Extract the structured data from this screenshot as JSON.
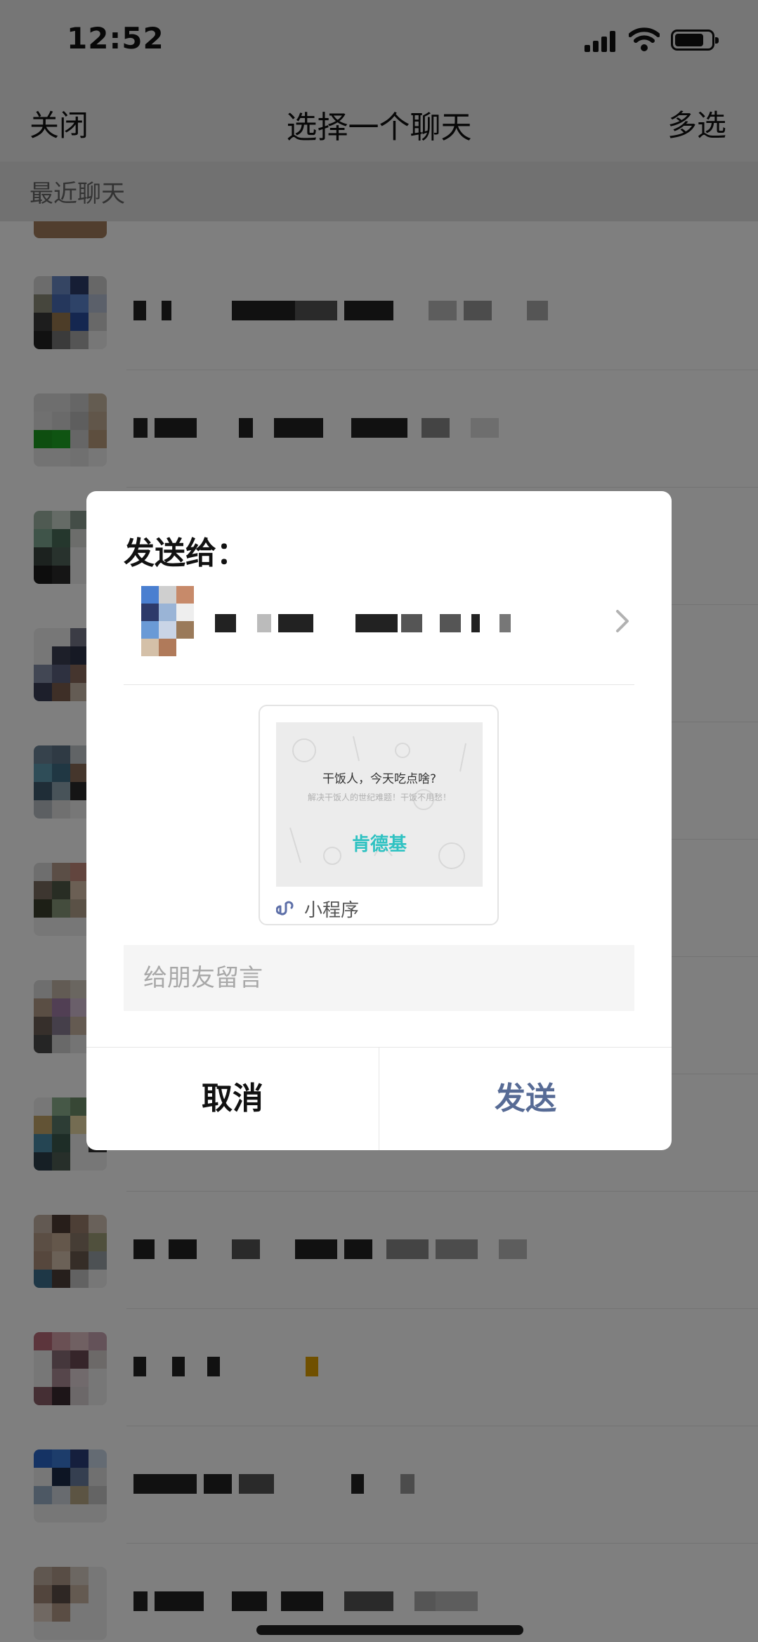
{
  "status_bar": {
    "time": "12:52"
  },
  "nav": {
    "left": "关闭",
    "title": "选择一个聊天",
    "right": "多选"
  },
  "section": {
    "label": "最近聊天"
  },
  "dialog": {
    "title": "发送给：",
    "card": {
      "headline": "干饭人，今天吃点啥?",
      "subline": "解决干饭人的世纪难题！干饭不用愁！",
      "brand": "肯德基",
      "brand_color": "#2fc2c2",
      "type_label": "小程序"
    },
    "message_placeholder": "给朋友留言",
    "message_value": "",
    "cancel_label": "取消",
    "send_label": "发送",
    "send_color": "#576b95"
  }
}
